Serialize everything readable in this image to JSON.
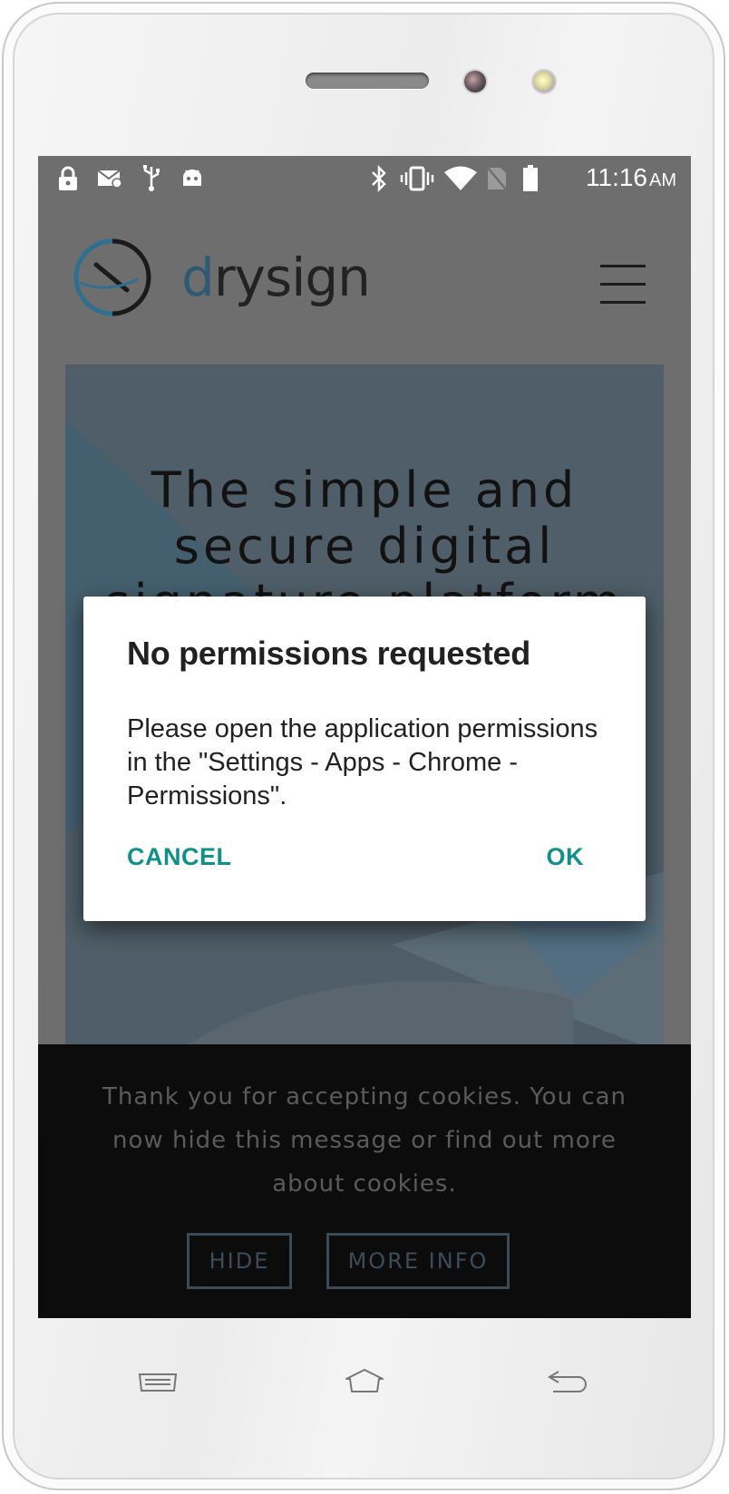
{
  "colors": {
    "accent": "#11908a",
    "scrim": "#6e6e6e",
    "cookie_bg": "#0c0c0c",
    "hero_bg": "#4f5e68"
  },
  "status_bar": {
    "left_icons": [
      "lock-icon",
      "mail-settings-icon",
      "usb-icon",
      "android-debug-icon"
    ],
    "right_icons": [
      "bluetooth-icon",
      "vibrate-icon",
      "wifi-icon",
      "no-sim-icon",
      "battery-icon"
    ],
    "time": "11:16",
    "ampm": "AM"
  },
  "site": {
    "logo_prefix": "d",
    "logo_rest": "rysign",
    "menu_icon": "hamburger-menu-icon",
    "hero_title": "The simple and secure digital signature platform"
  },
  "dialog": {
    "title": "No permissions requested",
    "body": "Please open the application permissions in the \"Settings - Apps - Chrome - Permissions\".",
    "cancel_label": "CANCEL",
    "ok_label": "OK"
  },
  "cookie_banner": {
    "text": "Thank you for accepting cookies. You can now hide this message or find out more about cookies.",
    "hide_label": "HIDE",
    "more_label": "MORE INFO"
  },
  "nav_bar": {
    "icons": [
      "recents-icon",
      "home-icon",
      "back-icon"
    ]
  }
}
